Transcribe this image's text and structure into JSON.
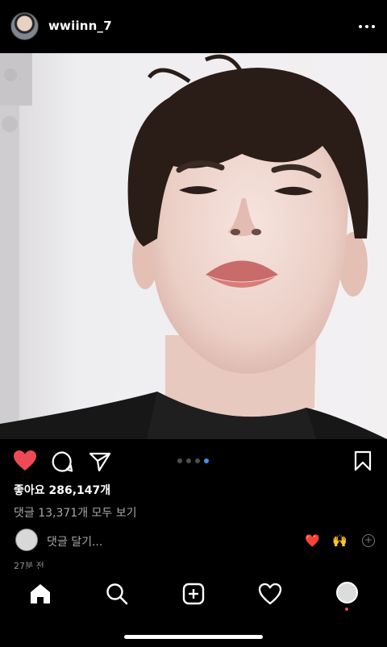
{
  "post": {
    "username": "wwiinn_7",
    "likes_text": "좋아요 286,147개",
    "comments_link": "댓글 13,371개 모두 보기",
    "time": "27분 전",
    "carousel": {
      "count": 4,
      "active_index": 3
    }
  },
  "comment_bar": {
    "placeholder": "댓글 달기...",
    "quick_reactions": [
      "❤️",
      "🙌"
    ]
  },
  "colors": {
    "like": "#ed4956",
    "active_dot": "#3897f0"
  },
  "icons": {
    "header": [
      "more-icon"
    ],
    "actions": [
      "heart-icon",
      "comment-icon",
      "share-icon",
      "bookmark-icon"
    ],
    "tabs": [
      "home-icon",
      "search-icon",
      "add-icon",
      "activity-icon",
      "profile-icon"
    ]
  }
}
